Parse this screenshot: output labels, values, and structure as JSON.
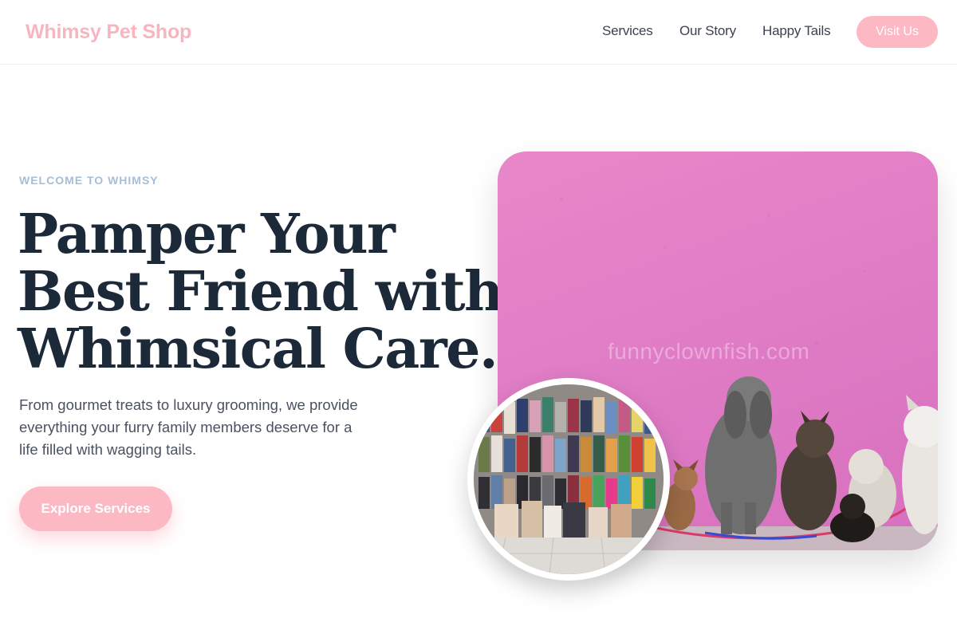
{
  "header": {
    "logo": "Whimsy Pet Shop",
    "nav": [
      "Services",
      "Our Story",
      "Happy Tails"
    ],
    "visit_label": "Visit Us"
  },
  "hero": {
    "eyebrow": "WELCOME TO WHIMSY",
    "headline_lines": [
      "Pamper Your",
      "Best Friend with",
      "Whimsical Care."
    ],
    "description_lines": [
      "From gourmet treats to luxury grooming, we provide",
      "everything your furry family members deserve for a",
      "life filled with wagging tails."
    ],
    "cta_label": "Explore Services",
    "main_image": {
      "icon": "dogs-photo",
      "watermark": "funnyclownfish.com",
      "wall_color": "#e07dc6"
    },
    "inset_image": {
      "icon": "pet-store-photo"
    }
  },
  "colors": {
    "brand_pink": "#fcb8c3",
    "heading_navy": "#1c2939",
    "eyebrow_blue": "#a7bed6"
  }
}
